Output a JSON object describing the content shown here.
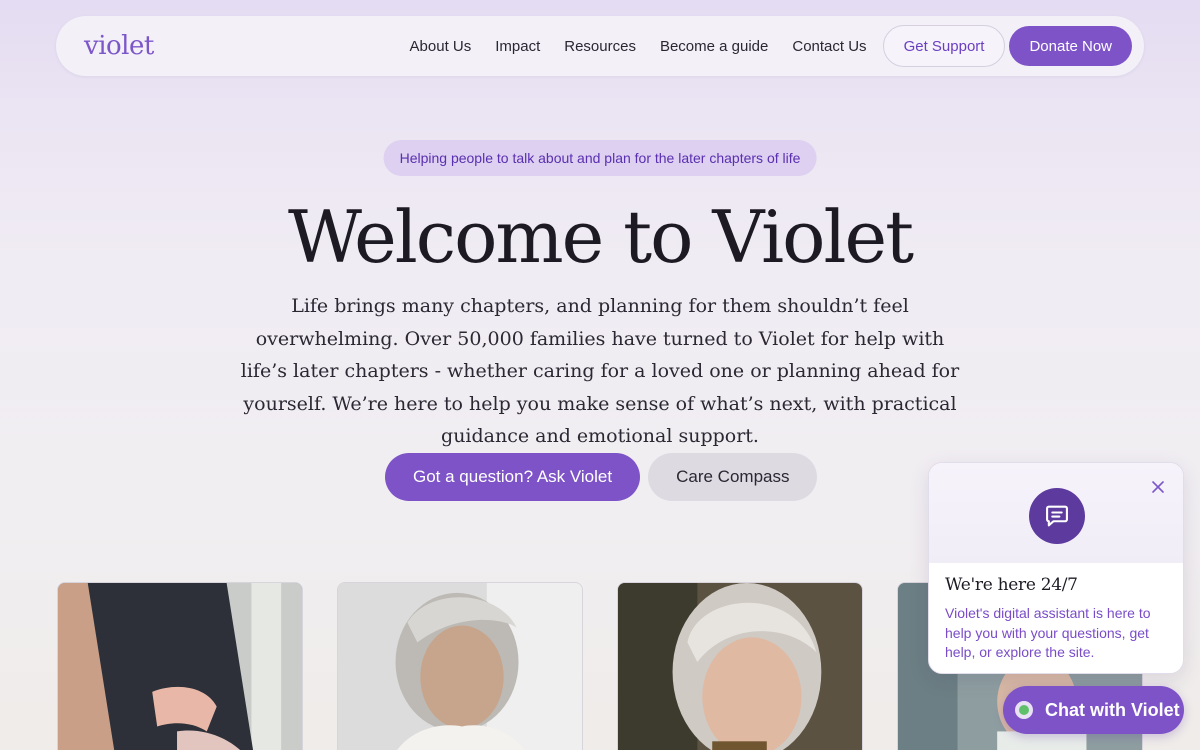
{
  "brand": {
    "logo_text": "violet",
    "accent": "#7d53c7",
    "accent_dark": "#5d3a9e"
  },
  "nav": {
    "links": [
      "About Us",
      "Impact",
      "Resources",
      "Become a guide",
      "Contact Us"
    ],
    "support_label": "Get Support",
    "donate_label": "Donate Now"
  },
  "hero": {
    "tagline": "Helping people to talk about and plan for the later chapters of life",
    "title": "Welcome to Violet",
    "copy": "Life brings many chapters, and planning for them shouldn’t feel overwhelming. Over 50,000 families have turned to Violet for help with life’s later chapters - whether caring for a loved one or planning ahead for yourself. We’re here to help you make sense of what’s next, with practical guidance and emotional support.",
    "primary_cta": "Got a question? Ask Violet",
    "secondary_cta": "Care Compass"
  },
  "chat": {
    "icon": "chat-bubble-icon",
    "close_icon": "close-icon",
    "heading": "We're here 24/7",
    "body": "Violet's digital assistant is here to help you with your questions, get help, or explore the site.",
    "launcher_label": "Chat with Violet",
    "status_color": "#5fbf6a"
  }
}
